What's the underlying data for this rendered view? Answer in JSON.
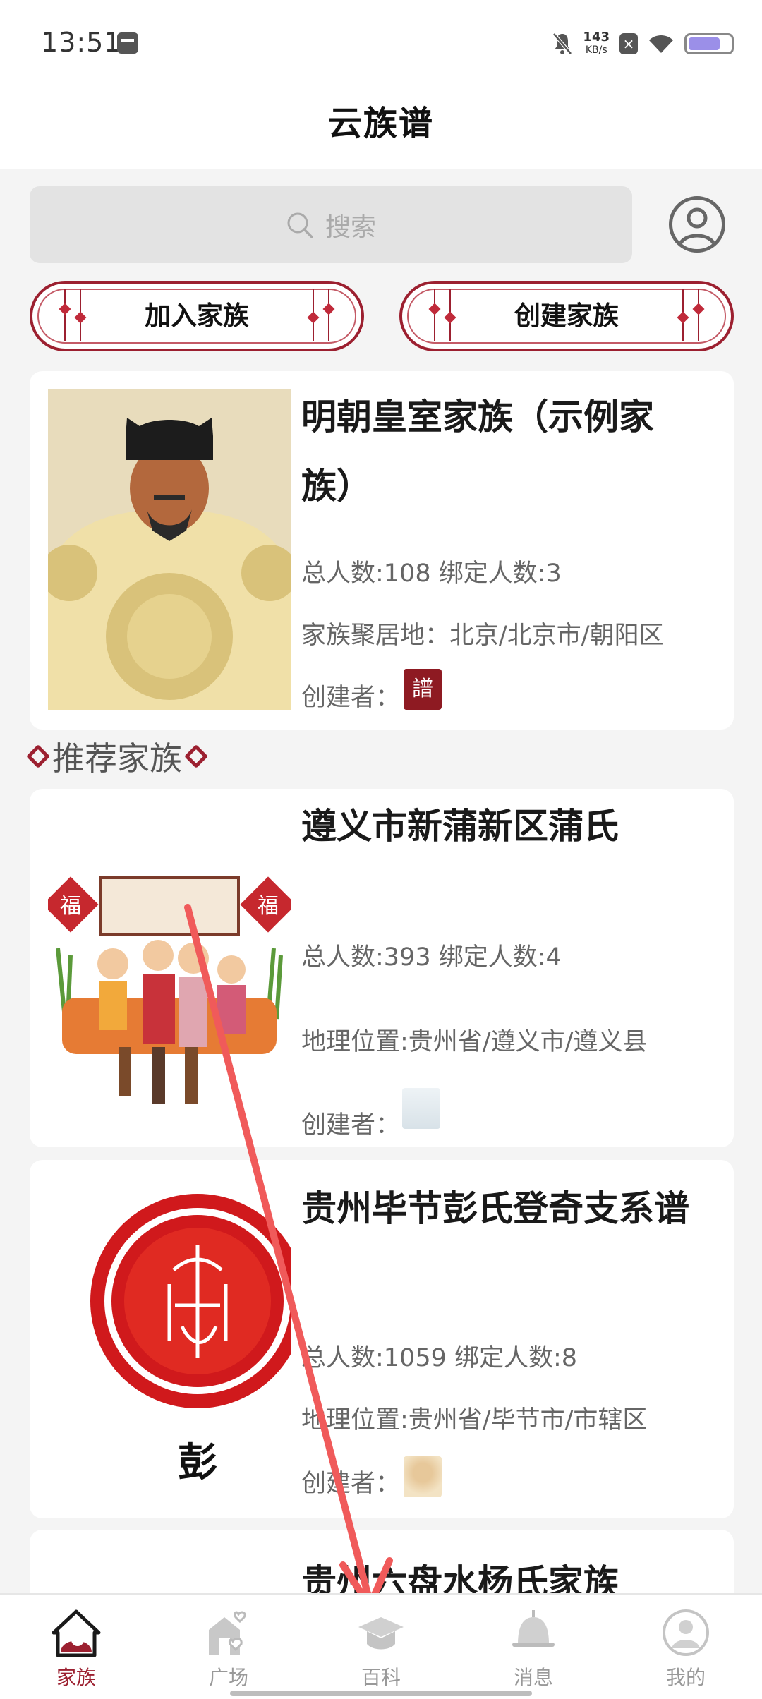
{
  "status_bar": {
    "time": "13:51",
    "net_speed_value": "143",
    "net_speed_unit": "KB/s",
    "battery_level": 0.75
  },
  "header": {
    "title": "云族谱"
  },
  "search": {
    "placeholder": "搜索"
  },
  "actions": {
    "join_label": "加入家族",
    "create_label": "创建家族"
  },
  "my_family": {
    "title": "明朝皇室家族（示例家族）",
    "stats": "总人数:108 绑定人数:3",
    "location": "家族聚居地：北京/北京市/朝阳区",
    "creator_label": "创建者：",
    "creator_avatar_text": "譜"
  },
  "recommended": {
    "heading": "推荐家族",
    "families": [
      {
        "title": "遵义市新蒲新区蒲氏",
        "stats": "总人数:393 绑定人数:4",
        "location": "地理位置:贵州省/遵义市/遵义县",
        "creator_label": "创建者：",
        "image_chars": [
          "福",
          "福"
        ]
      },
      {
        "title": "贵州毕节彭氏登奇支系谱",
        "stats": "总人数:1059 绑定人数:8",
        "location": "地理位置:贵州省/毕节市/市辖区",
        "creator_label": "创建者：",
        "image_caption": "彭"
      },
      {
        "title": "贵州六盘水杨氏家族"
      }
    ]
  },
  "nav": {
    "items": [
      {
        "label": "家族",
        "icon": "family-home-icon",
        "active": true
      },
      {
        "label": "广场",
        "icon": "plaza-icon",
        "active": false
      },
      {
        "label": "百科",
        "icon": "encyclopedia-icon",
        "active": false
      },
      {
        "label": "消息",
        "icon": "bell-icon",
        "active": false
      },
      {
        "label": "我的",
        "icon": "profile-icon",
        "active": false
      }
    ]
  },
  "colors": {
    "accent": "#9c2030",
    "overlay_arrow": "#f05a5a"
  }
}
